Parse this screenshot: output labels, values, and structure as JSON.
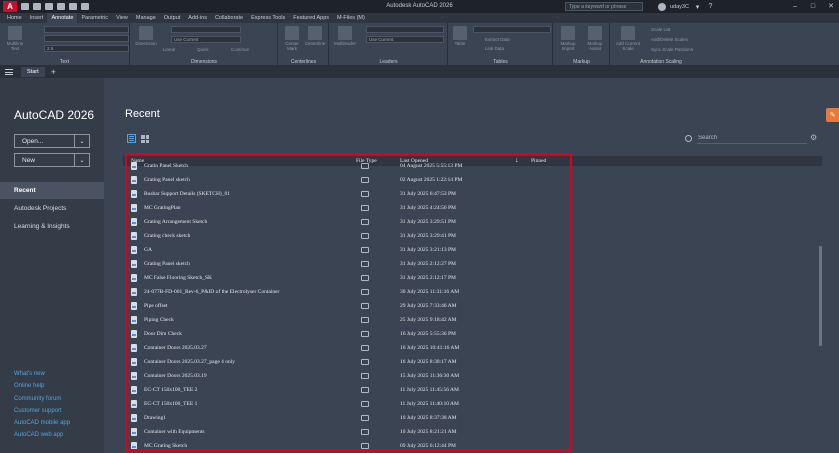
{
  "window": {
    "title": "Autodesk AutoCAD 2026",
    "app_logo": "A",
    "search_placeholder": "Type a keyword or phrase",
    "user": "uday3C"
  },
  "ribbon_tabs": [
    "Home",
    "Insert",
    "Annotate",
    "Parametric",
    "View",
    "Manage",
    "Output",
    "Add-ins",
    "Collaborate",
    "Express Tools",
    "Featured Apps",
    "M-Files (M)"
  ],
  "ribbon_active_tab": "Annotate",
  "ribbon": {
    "text_panel": {
      "label": "Text",
      "button": "Multiline Text",
      "style_value": "2.5"
    },
    "dimensions_panel": {
      "label": "Dimensions",
      "buttons": [
        "Dimension",
        "Linear",
        "Quick",
        "Continue"
      ],
      "layer_value": "Use Current"
    },
    "centerlines_panel": {
      "label": "Centerlines",
      "buttons": [
        "Center Mark",
        "Centerline"
      ]
    },
    "leaders_panel": {
      "label": "Leaders",
      "button": "Multileader",
      "layer_value": "Use Current"
    },
    "tables_panel": {
      "label": "Tables",
      "buttons": [
        "Table",
        "Extract Data",
        "Link Data"
      ]
    },
    "markup_panel": {
      "label": "Markup",
      "buttons": [
        "Markup Import",
        "Markup Assist"
      ]
    },
    "scaling_panel": {
      "label": "Annotation Scaling",
      "buttons": [
        "Add Current Scale",
        "Scale List",
        "Add/Delete Scales",
        "Sync Scale Positions"
      ]
    }
  },
  "doc_tabs": {
    "active": "Start"
  },
  "sidebar": {
    "product": "AutoCAD 2026",
    "open_label": "Open...",
    "new_label": "New",
    "nav": [
      "Recent",
      "Autodesk Projects",
      "Learning & Insights"
    ],
    "active_nav": "Recent",
    "links": [
      "What's new",
      "Online help",
      "Community forum",
      "Customer support",
      "AutoCAD mobile app",
      "AutoCAD web app"
    ]
  },
  "main": {
    "title": "Recent",
    "search_placeholder": "Search",
    "columns": {
      "name": "Name",
      "type": "File Type",
      "opened": "Last Opened",
      "pinned": "Pinned"
    },
    "files": [
      {
        "name": "Gratin Panel Sketch",
        "date": "04 August 2025 5:55:13 PM"
      },
      {
        "name": "Grating Panel sketch",
        "date": "02 August 2025 1:22:14 PM"
      },
      {
        "name": "Busbar Support Details (SKETCH)_01",
        "date": "31 July 2025 6:47:53 PM"
      },
      {
        "name": "MC GratingPlan",
        "date": "31 July 2025 4:24:56 PM"
      },
      {
        "name": "Grating Arrangement Sketch",
        "date": "31 July 2025 3:29:51 PM"
      },
      {
        "name": "Grating check sketch",
        "date": "31 July 2025 3:29:41 PM"
      },
      {
        "name": "GA",
        "date": "31 July 2025 3:21:13 PM"
      },
      {
        "name": "Grating Panel sketch",
        "date": "31 July 2025 2:12:27 PM"
      },
      {
        "name": "MC False Flooring Sketch_SK",
        "date": "31 July 2025 2:12:17 PM"
      },
      {
        "name": "24-077B-FD-001_Rev-6_P&ID of the Electrolyser Container",
        "date": "30 July 2025 11:31:16 AM"
      },
      {
        "name": "Pipe offset",
        "date": "29 July 2025 7:33:46 AM"
      },
      {
        "name": "Piping Check",
        "date": "25 July 2025 9:18:42 AM"
      },
      {
        "name": "Door Dim Check",
        "date": "16 July 2025 5:55:36 PM"
      },
      {
        "name": "Container Doors 2025.03.27",
        "date": "16 July 2025 10:41:16 AM"
      },
      {
        "name": "Container Doors 2025.03.27_page 4 only",
        "date": "16 July 2025 8:38:17 AM"
      },
      {
        "name": "Container Doors 2025.03.19",
        "date": "15 July 2025 11:36:30 AM"
      },
      {
        "name": "EC-CT 150x100_TEE 2",
        "date": "11 July 2025 11:45:56 AM"
      },
      {
        "name": "EC-CT 150x100_TEE 1",
        "date": "11 July 2025 11:40:10 AM"
      },
      {
        "name": "Drawing1",
        "date": "10 July 2025 8:37:38 AM"
      },
      {
        "name": "Container with Equipments",
        "date": "10 July 2025 8:21:21 AM"
      },
      {
        "name": "MC Grating Sketch",
        "date": "09 July 2025 6:12:44 PM"
      }
    ]
  }
}
